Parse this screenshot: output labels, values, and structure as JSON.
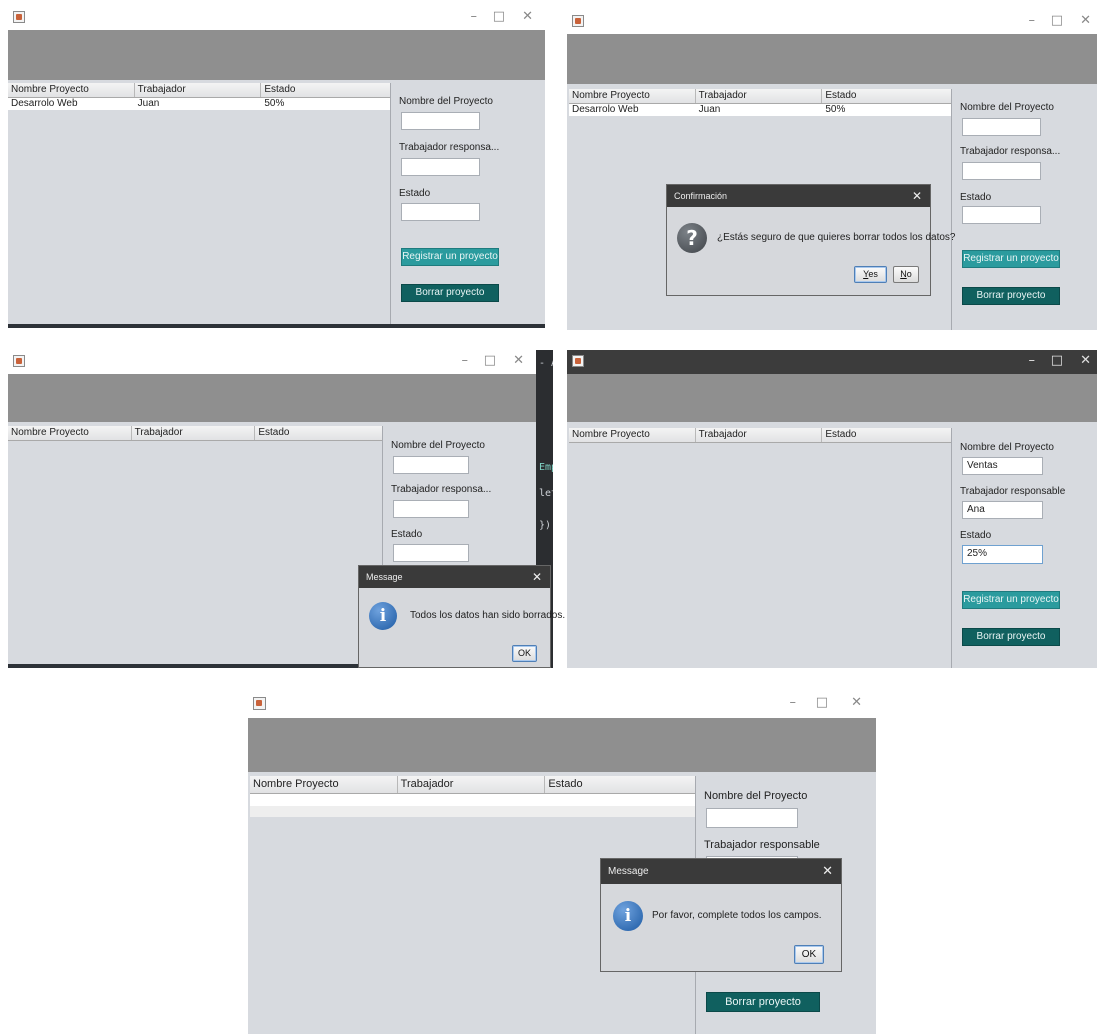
{
  "window": {
    "minimize_glyph": "–",
    "maximize_glyph": "□",
    "close_glyph": "✕"
  },
  "table": {
    "columns": [
      "Nombre Proyecto",
      "Trabajador",
      "Estado"
    ]
  },
  "panels": [
    {
      "rows": [
        [
          "Desarrolo Web",
          "Juan",
          "50%"
        ]
      ],
      "form": {
        "label_nombre": "Nombre del Proyecto",
        "label_trabajador": "Trabajador responsa...",
        "label_estado": "Estado",
        "value_nombre": "",
        "value_trabajador": "",
        "value_estado": "",
        "register_label": "Registrar un proyecto",
        "delete_label": "Borrar proyecto"
      }
    },
    {
      "rows": [
        [
          "Desarrolo Web",
          "Juan",
          "50%"
        ]
      ],
      "form": {
        "label_nombre": "Nombre del Proyecto",
        "label_trabajador": "Trabajador responsa...",
        "label_estado": "Estado",
        "register_label": "Registrar un proyecto",
        "delete_label": "Borrar proyecto"
      },
      "dialog": {
        "title": "Confirmación",
        "icon": "question-icon",
        "message": "¿Estás seguro de que quieres borrar todos los datos?",
        "yes_label": "Yes",
        "yes_mnemonic": "Y",
        "yes_rest": "es",
        "no_label": "No",
        "no_mnemonic": "N",
        "no_rest": "o"
      }
    },
    {
      "rows": [],
      "form": {
        "label_nombre": "Nombre del Proyecto",
        "label_trabajador": "Trabajador responsa...",
        "label_estado": "Estado"
      },
      "dialog": {
        "title": "Message",
        "icon": "information-icon",
        "message": "Todos los datos han sido borrados.",
        "ok_label": "OK"
      },
      "background_ide_text": [
        "- Ap",
        "Empt",
        "lete",
        "});"
      ]
    },
    {
      "rows": [],
      "form": {
        "label_nombre": "Nombre del Proyecto",
        "label_trabajador": "Trabajador responsable",
        "label_estado": "Estado",
        "value_nombre": "Ventas",
        "value_trabajador": "Ana",
        "value_estado": "25%",
        "register_label": "Registrar un proyecto",
        "delete_label": "Borrar proyecto"
      }
    },
    {
      "rows": [
        [
          "",
          "",
          ""
        ]
      ],
      "form": {
        "label_nombre": "Nombre del Proyecto",
        "label_trabajador": "Trabajador responsable",
        "delete_label": "Borrar proyecto"
      },
      "dialog": {
        "title": "Message",
        "icon": "information-icon",
        "message": "Por favor, complete todos los campos.",
        "ok_label": "OK"
      }
    }
  ]
}
